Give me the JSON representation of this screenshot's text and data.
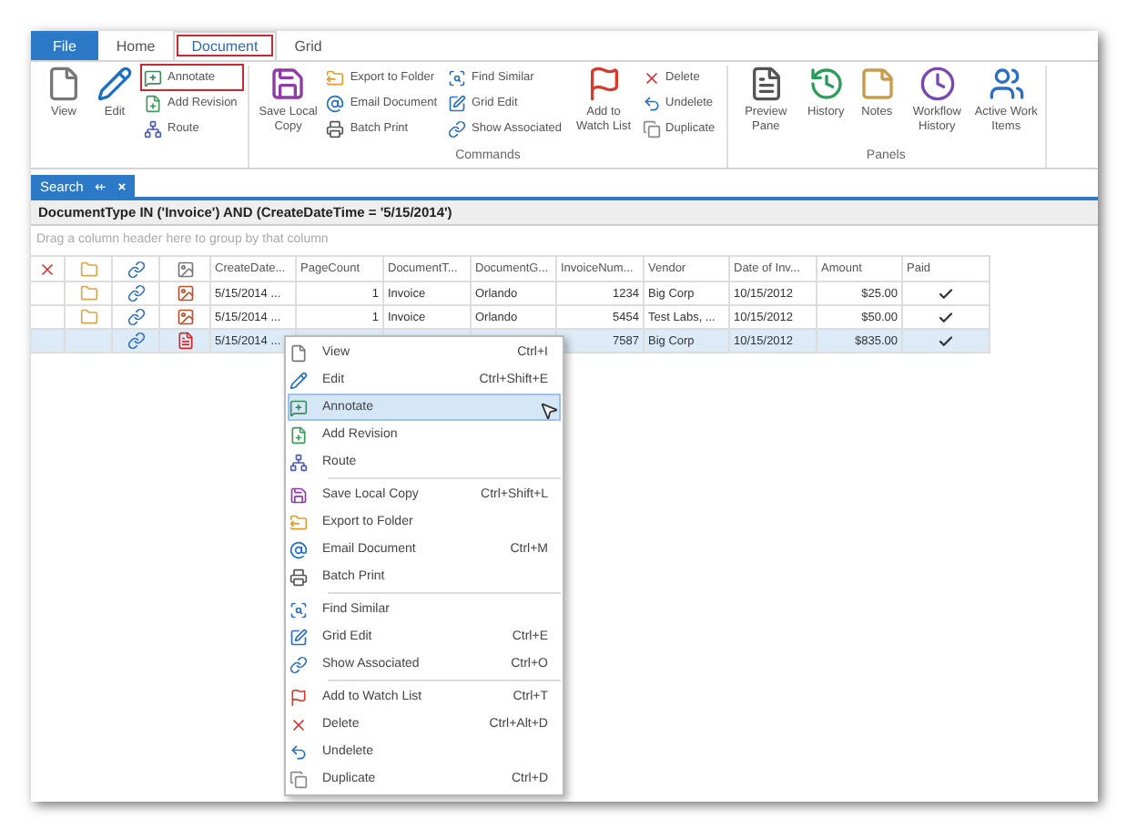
{
  "ribbon_tabs": [
    {
      "label": "File",
      "kind": "file",
      "selected": false,
      "highlighted": false
    },
    {
      "label": "Home",
      "kind": "tab",
      "selected": false,
      "highlighted": false
    },
    {
      "label": "Document",
      "kind": "tab",
      "selected": true,
      "highlighted": true
    },
    {
      "label": "Grid",
      "kind": "tab",
      "selected": false,
      "highlighted": false
    }
  ],
  "ribbon_groups": [
    {
      "sections": [
        {
          "kind": "large",
          "items": [
            {
              "label": "View",
              "highlighted": false
            },
            {
              "label": "Edit",
              "highlighted": false
            }
          ]
        },
        {
          "kind": "small",
          "items": [
            {
              "label": "Annotate",
              "highlighted": true
            },
            {
              "label": "Add Revision",
              "highlighted": false
            },
            {
              "label": "Route",
              "highlighted": false
            }
          ]
        }
      ]
    },
    {
      "label": "Commands",
      "sections": [
        {
          "kind": "large",
          "items": [
            {
              "label": "Save Local Copy",
              "highlighted": false
            }
          ]
        },
        {
          "kind": "small",
          "items": [
            {
              "label": "Export to Folder",
              "highlighted": false
            },
            {
              "label": "Email Document",
              "highlighted": false
            },
            {
              "label": "Batch Print",
              "highlighted": false
            }
          ]
        },
        {
          "kind": "small",
          "items": [
            {
              "label": "Find Similar",
              "highlighted": false
            },
            {
              "label": "Grid Edit",
              "highlighted": false
            },
            {
              "label": "Show Associated",
              "highlighted": false
            }
          ]
        },
        {
          "kind": "large",
          "items": [
            {
              "label": "Add to Watch List",
              "highlighted": false
            }
          ]
        },
        {
          "kind": "small",
          "items": [
            {
              "label": "Delete",
              "highlighted": false
            },
            {
              "label": "Undelete",
              "highlighted": false
            },
            {
              "label": "Duplicate",
              "highlighted": false
            }
          ]
        }
      ]
    },
    {
      "label": "Panels",
      "sections": [
        {
          "kind": "large",
          "items": [
            {
              "label": "Preview Pane",
              "highlighted": false
            },
            {
              "label": "History",
              "highlighted": false
            },
            {
              "label": "Notes",
              "highlighted": false
            },
            {
              "label": "Workflow History",
              "highlighted": false
            },
            {
              "label": "Active Work Items",
              "highlighted": false
            }
          ]
        }
      ]
    }
  ],
  "document_tab": {
    "label": "Search",
    "pin": "⇷",
    "close": "×"
  },
  "filter": "DocumentType IN ('Invoice') AND (CreateDateTime = '5/15/2014')",
  "group_hint": "Drag a column header here to group by that column",
  "table": {
    "columns": [
      {
        "label": "CreateDate...",
        "numeric": false
      },
      {
        "label": "PageCount",
        "numeric": true
      },
      {
        "label": "DocumentT...",
        "numeric": false
      },
      {
        "label": "DocumentG...",
        "numeric": false
      },
      {
        "label": "InvoiceNum...",
        "numeric": true
      },
      {
        "label": "Vendor",
        "numeric": false
      },
      {
        "label": "Date of Inv...",
        "numeric": false
      },
      {
        "label": "Amount",
        "numeric": true
      }
    ],
    "paid_column": "Paid",
    "rows": [
      {
        "selected": false,
        "folder": true,
        "pdf": false,
        "cells": [
          "5/15/2014 ...",
          "1",
          "Invoice",
          "Orlando",
          "1234",
          "Big Corp",
          "10/15/2012",
          "$25.00"
        ],
        "paid": true
      },
      {
        "selected": false,
        "folder": true,
        "pdf": false,
        "cells": [
          "5/15/2014 ...",
          "1",
          "Invoice",
          "Orlando",
          "5454",
          "Test Labs, ...",
          "10/15/2012",
          "$50.00"
        ],
        "paid": true
      },
      {
        "selected": true,
        "folder": false,
        "pdf": true,
        "cells": [
          "5/15/2014 ...",
          null,
          null,
          null,
          "7587",
          "Big Corp",
          "10/15/2012",
          "$835.00"
        ],
        "paid": true
      }
    ]
  },
  "context_menu": [
    [
      {
        "label": "View",
        "shortcut": "Ctrl+I",
        "hovered": false
      },
      {
        "label": "Edit",
        "shortcut": "Ctrl+Shift+E",
        "hovered": false
      },
      {
        "label": "Annotate",
        "hovered": true
      },
      {
        "label": "Add Revision",
        "hovered": false
      },
      {
        "label": "Route",
        "hovered": false
      }
    ],
    [
      {
        "label": "Save Local Copy",
        "shortcut": "Ctrl+Shift+L",
        "hovered": false
      },
      {
        "label": "Export to Folder",
        "hovered": false
      },
      {
        "label": "Email Document",
        "shortcut": "Ctrl+M",
        "hovered": false
      },
      {
        "label": "Batch Print",
        "hovered": false
      }
    ],
    [
      {
        "label": "Find Similar",
        "hovered": false
      },
      {
        "label": "Grid Edit",
        "shortcut": "Ctrl+E",
        "hovered": false
      },
      {
        "label": "Show Associated",
        "shortcut": "Ctrl+O",
        "hovered": false
      }
    ],
    [
      {
        "label": "Add to Watch List",
        "shortcut": "Ctrl+T",
        "hovered": false
      },
      {
        "label": "Delete",
        "shortcut": "Ctrl+Alt+D",
        "hovered": false
      },
      {
        "label": "Undelete",
        "hovered": false
      },
      {
        "label": "Duplicate",
        "shortcut": "Ctrl+D",
        "hovered": false
      }
    ]
  ]
}
